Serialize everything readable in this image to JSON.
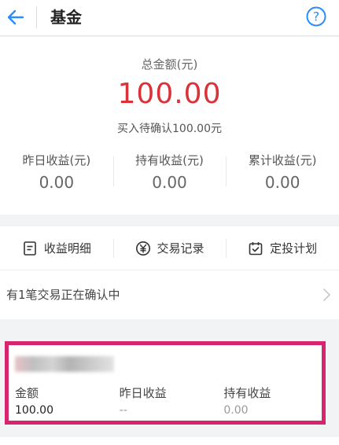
{
  "header": {
    "title": "基金",
    "back_icon": "arrow-left-icon",
    "help_icon": "question-circle-icon",
    "help_glyph": "?",
    "accent_color": "#2a8cff"
  },
  "summary": {
    "total_label": "总金额(元)",
    "total_amount": "100.00",
    "total_color": "#d9323a",
    "pending_text": "买入待确认100.00元",
    "stats": [
      {
        "label": "昨日收益(元)",
        "value": "0.00"
      },
      {
        "label": "持有收益(元)",
        "value": "0.00"
      },
      {
        "label": "累计收益(元)",
        "value": "0.00"
      }
    ]
  },
  "actions": [
    {
      "label": "收益明细",
      "icon": "document-icon"
    },
    {
      "label": "交易记录",
      "icon": "yuan-circle-icon"
    },
    {
      "label": "定投计划",
      "icon": "calendar-check-icon"
    }
  ],
  "notice": {
    "text": "有1笔交易正在确认中",
    "icon": "chevron-right-icon"
  },
  "fund_card": {
    "highlight_color": "#d7246f",
    "columns": [
      {
        "label": "金额",
        "value": "100.00"
      },
      {
        "label": "昨日收益",
        "value": "--"
      },
      {
        "label": "持有收益",
        "value": "0.00"
      }
    ]
  }
}
